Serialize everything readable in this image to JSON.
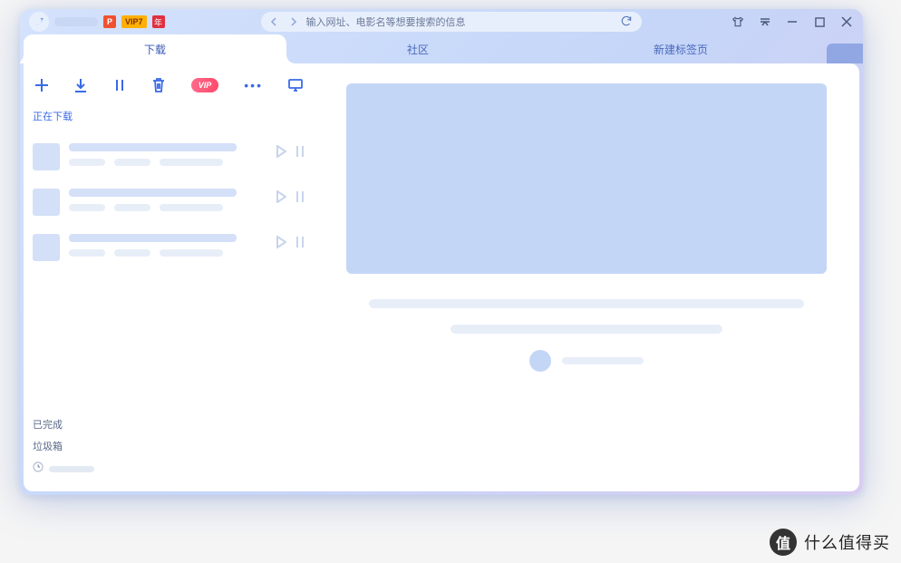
{
  "titlebar": {
    "badge_p": "P",
    "badge_vip": "VIP7",
    "badge_year": "年",
    "address_placeholder": "输入网址、电影名等想要搜索的信息"
  },
  "tabs": {
    "download": "下载",
    "community": "社区",
    "newtab": "新建标签页"
  },
  "toolbar": {
    "vip_label": "VIP"
  },
  "sections": {
    "downloading": "正在下载",
    "completed": "已完成",
    "trash": "垃圾箱"
  },
  "watermark": {
    "icon": "值",
    "text": "什么值得买"
  }
}
